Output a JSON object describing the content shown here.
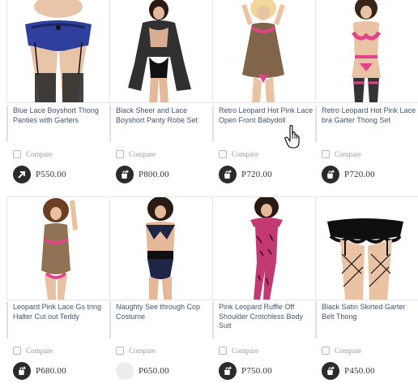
{
  "compare_label": "Compare",
  "products": [
    {
      "title": "Blue Lace Boyshort Thong Panties with Garters",
      "price": "P550.00",
      "button_icon": "arrow-up-right-icon"
    },
    {
      "title": "Black Sheer and Lace Boyshort Panty Robe Set",
      "price": "P800.00",
      "button_icon": "add-to-cart-icon"
    },
    {
      "title": "Retro Leopard Hot Pink Lace Open Front Babydoll",
      "price": "P720.00",
      "button_icon": "add-to-cart-icon"
    },
    {
      "title": "Retro Leopard Hot Pink Lace bra Garter Thong Set",
      "price": "P720.00",
      "button_icon": "add-to-cart-icon"
    },
    {
      "title": "Leopard Pink Lace Gs tring Halter Cut out Teddy",
      "price": "P680.00",
      "button_icon": "add-to-cart-icon"
    },
    {
      "title": "Naughty See through Cop Costume",
      "price": "P650.00",
      "button_icon": "loading-placeholder-icon"
    },
    {
      "title": "Pink Leopard Ruffle Off Shoulder Crotchless Body Suit",
      "price": "P750.00",
      "button_icon": "add-to-cart-icon"
    },
    {
      "title": "Black Satin Skirted Garter Belt Thong",
      "price": "P450.00",
      "button_icon": "add-to-cart-icon"
    }
  ],
  "colors": {
    "button": "#2b2b2b",
    "text": "#44546a",
    "pink": "#e0458a"
  },
  "cursor_icon": "hand-pointer-icon"
}
